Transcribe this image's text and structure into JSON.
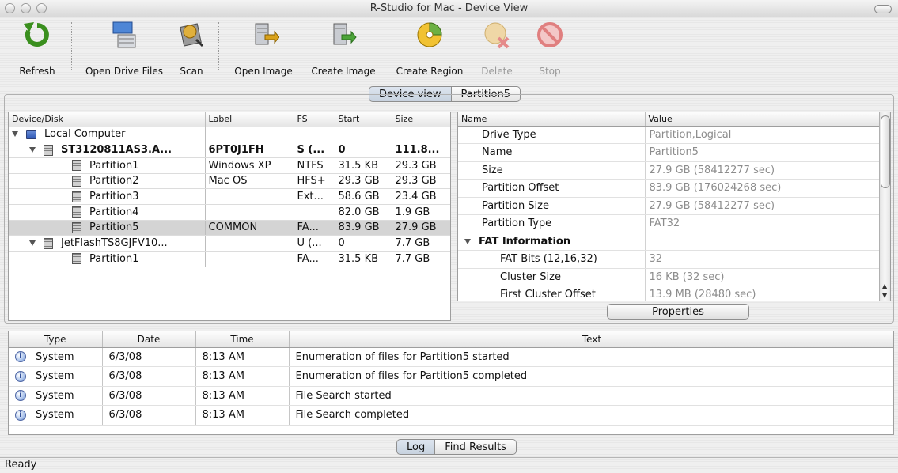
{
  "window": {
    "title": "R-Studio for Mac - Device View"
  },
  "toolbar": {
    "refresh": "Refresh",
    "open_drive_files": "Open Drive Files",
    "scan": "Scan",
    "open_image": "Open Image",
    "create_image": "Create Image",
    "create_region": "Create Region",
    "delete": "Delete",
    "stop": "Stop"
  },
  "view_tabs": {
    "device_view": "Device view",
    "partition5": "Partition5"
  },
  "device_table": {
    "headers": [
      "Device/Disk",
      "Label",
      "FS",
      "Start",
      "Size"
    ],
    "rows": [
      {
        "name": "Local Computer",
        "label": "",
        "fs": "",
        "start": "",
        "size": ""
      },
      {
        "name": "ST3120811AS3.A...",
        "label": "6PT0J1FH",
        "fs": "S (...",
        "start": "0",
        "size": "111.8..."
      },
      {
        "name": "Partition1",
        "label": "Windows XP",
        "fs": "NTFS",
        "start": "31.5 KB",
        "size": "29.3 GB"
      },
      {
        "name": "Partition2",
        "label": "Mac OS",
        "fs": "HFS+",
        "start": "29.3 GB",
        "size": "29.3 GB"
      },
      {
        "name": "Partition3",
        "label": "",
        "fs": "Ext...",
        "start": "58.6 GB",
        "size": "23.4 GB"
      },
      {
        "name": "Partition4",
        "label": "",
        "fs": "",
        "start": "82.0 GB",
        "size": "1.9 GB"
      },
      {
        "name": "Partition5",
        "label": "COMMON",
        "fs": "FA...",
        "start": "83.9 GB",
        "size": "27.9 GB"
      },
      {
        "name": "JetFlashTS8GJFV10...",
        "label": "",
        "fs": "U (...",
        "start": "0",
        "size": "7.7 GB"
      },
      {
        "name": "Partition1",
        "label": "",
        "fs": "FA...",
        "start": "31.5 KB",
        "size": "7.7 GB"
      }
    ]
  },
  "properties": {
    "headers": [
      "Name",
      "Value"
    ],
    "rows": [
      {
        "name": "Drive Type",
        "value": "Partition,Logical"
      },
      {
        "name": "Name",
        "value": "Partition5"
      },
      {
        "name": "Size",
        "value": "27.9 GB (58412277 sec)"
      },
      {
        "name": "Partition Offset",
        "value": "83.9 GB (176024268 sec)"
      },
      {
        "name": "Partition Size",
        "value": "27.9 GB (58412277 sec)"
      },
      {
        "name": "Partition Type",
        "value": "FAT32"
      },
      {
        "name": "FAT Information",
        "value": ""
      },
      {
        "name": "FAT Bits (12,16,32)",
        "value": "32"
      },
      {
        "name": "Cluster Size",
        "value": "16 KB (32 sec)"
      },
      {
        "name": "First Cluster Offset",
        "value": "13.9 MB (28480 sec)"
      }
    ],
    "button": "Properties"
  },
  "log": {
    "headers": [
      "Type",
      "Date",
      "Time",
      "Text"
    ],
    "rows": [
      {
        "type": "System",
        "date": "6/3/08",
        "time": "8:13 AM",
        "text": "Enumeration of files for Partition5 started"
      },
      {
        "type": "System",
        "date": "6/3/08",
        "time": "8:13 AM",
        "text": "Enumeration of files for Partition5 completed"
      },
      {
        "type": "System",
        "date": "6/3/08",
        "time": "8:13 AM",
        "text": "File Search started"
      },
      {
        "type": "System",
        "date": "6/3/08",
        "time": "8:13 AM",
        "text": "File Search completed"
      }
    ],
    "tabs": {
      "log": "Log",
      "find_results": "Find Results"
    }
  },
  "status": {
    "text": "Ready"
  },
  "icon_glyphs": {
    "info": "i"
  }
}
